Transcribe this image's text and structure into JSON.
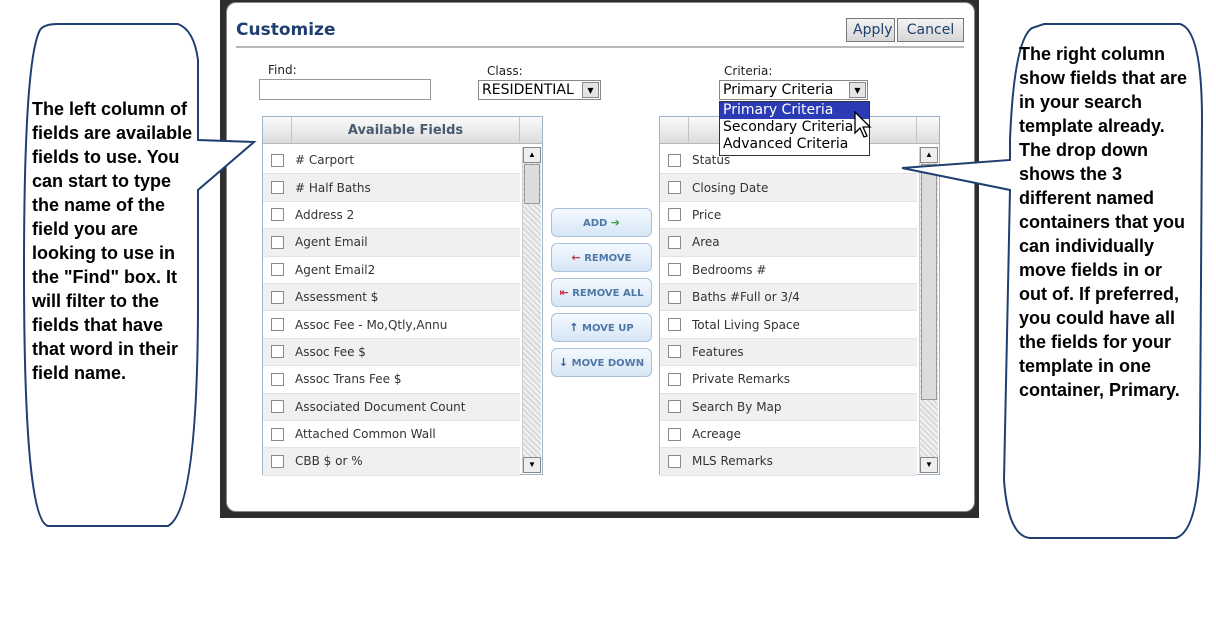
{
  "dialog": {
    "title": "Customize",
    "apply_label": "Apply",
    "cancel_label": "Cancel"
  },
  "filters": {
    "find_label": "Find:",
    "find_value": "",
    "class_label": "Class:",
    "class_value": "RESIDENTIAL",
    "criteria_label": "Criteria:",
    "criteria_value": "Primary Criteria",
    "criteria_options": [
      "Primary Criteria",
      "Secondary Criteria",
      "Advanced Criteria"
    ]
  },
  "left_list": {
    "header": "Available Fields",
    "items": [
      "# Carport",
      "# Half Baths",
      "Address 2",
      "Agent Email",
      "Agent Email2",
      "Assessment $",
      "Assoc Fee - Mo,Qtly,Annu",
      "Assoc Fee $",
      "Assoc Trans Fee $",
      "Associated Document Count",
      "Attached Common Wall",
      "CBB $ or %"
    ]
  },
  "right_list": {
    "header": "",
    "items": [
      "Status",
      "Closing Date",
      "Price",
      "Area",
      "Bedrooms #",
      "Baths #Full or 3/4",
      "Total Living Space",
      "Features",
      "Private Remarks",
      "Search By Map",
      "Acreage",
      "MLS Remarks"
    ]
  },
  "actions": {
    "add": "ADD",
    "remove": "REMOVE",
    "remove_all": "REMOVE ALL",
    "move_up": "MOVE UP",
    "move_down": "MOVE DOWN"
  },
  "callouts": {
    "left": "The left column of fields are available fields to use. You can start to type the name of the field you are looking to use in the \"Find\" box. It will filter to the fields that have that word in their field name.",
    "right": "The right column show fields that are in your search template already. The drop down shows the 3 different named containers that you can individually move fields in or out of. If preferred, you could have all the fields for your template in one container, Primary."
  }
}
